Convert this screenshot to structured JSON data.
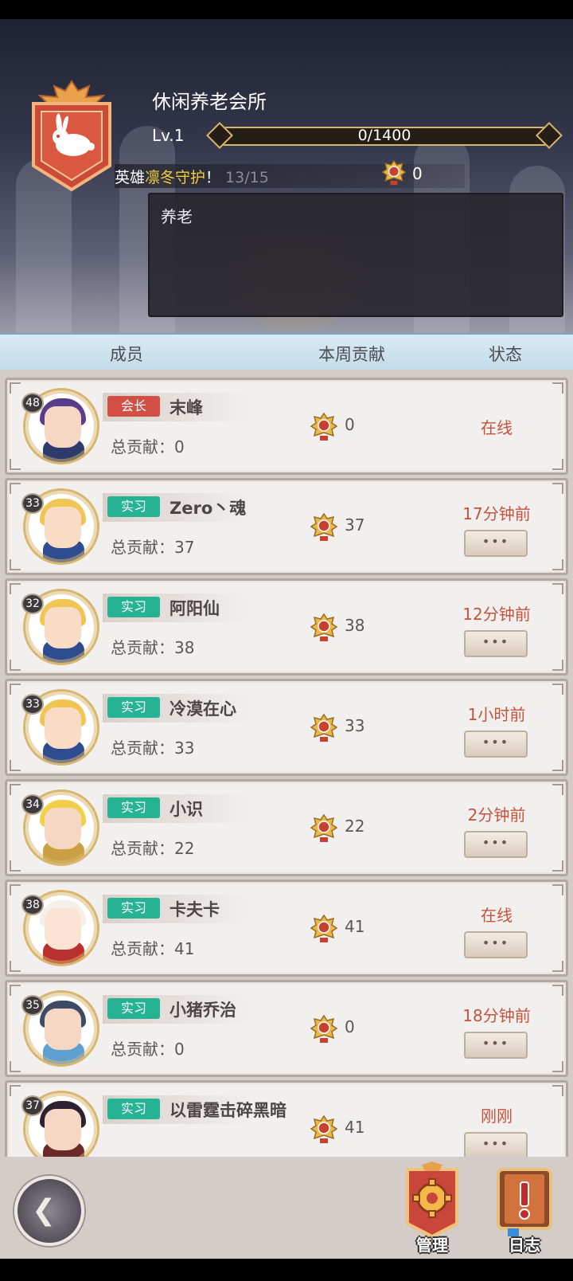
{
  "guild": {
    "name": "休闲养老会所",
    "level": "Lv.1",
    "xp": "0/1400",
    "xp_fraction": 0.0,
    "notice_prefix": "英雄",
    "notice_highlight": "凛冬守护",
    "notice_suffix": "！",
    "notice_count": "13/15",
    "trophies": "0",
    "description": "养老"
  },
  "columns": {
    "member": "成员",
    "weekly": "本周贡献",
    "status": "状态"
  },
  "members": [
    {
      "level": "48",
      "role": "会长",
      "role_type": "leader",
      "name": "末峰",
      "total": "总贡献：0",
      "weekly": "0",
      "status": "在线",
      "has_more": false
    },
    {
      "level": "33",
      "role": "实习",
      "role_type": "intern",
      "name": "Zero丶魂",
      "total": "总贡献：37",
      "weekly": "37",
      "status": "17分钟前",
      "has_more": true
    },
    {
      "level": "32",
      "role": "实习",
      "role_type": "intern",
      "name": "阿阳仙",
      "total": "总贡献：38",
      "weekly": "38",
      "status": "12分钟前",
      "has_more": true
    },
    {
      "level": "33",
      "role": "实习",
      "role_type": "intern",
      "name": "冷漠在心",
      "total": "总贡献：33",
      "weekly": "33",
      "status": "1小时前",
      "has_more": true
    },
    {
      "level": "34",
      "role": "实习",
      "role_type": "intern",
      "name": "小识",
      "total": "总贡献：22",
      "weekly": "22",
      "status": "2分钟前",
      "has_more": true
    },
    {
      "level": "38",
      "role": "实习",
      "role_type": "intern",
      "name": "卡夫卡",
      "total": "总贡献：41",
      "weekly": "41",
      "status": "在线",
      "has_more": true
    },
    {
      "level": "35",
      "role": "实习",
      "role_type": "intern",
      "name": "小猪乔治",
      "total": "总贡献：0",
      "weekly": "0",
      "status": "18分钟前",
      "has_more": true
    },
    {
      "level": "37",
      "role": "实习",
      "role_type": "intern",
      "name": "以雷霆击碎黑暗",
      "total": "",
      "weekly": "41",
      "status": "刚刚",
      "has_more": true
    }
  ],
  "more_label": "•••",
  "bottom": {
    "manage_label": "管理",
    "log_label": "日志"
  },
  "icons": {
    "back": "back-arrow-icon",
    "trophy": "trophy-icon",
    "manage": "gear-banner-icon",
    "log": "book-exclamation-icon"
  },
  "colors": {
    "leader_badge": "#d24f45",
    "intern_badge": "#26b394",
    "status_text": "#c5533c",
    "notice_highlight": "#f2cd3a"
  }
}
